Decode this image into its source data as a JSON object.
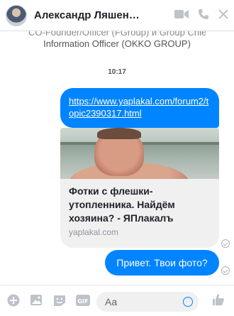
{
  "header": {
    "contact_name": "Александр Ляшенко",
    "icons": [
      "avatar",
      "video-call-icon",
      "phone-icon",
      "close-icon"
    ]
  },
  "previous_message": {
    "line1": "CO-Founder/Officer (FGroup) и Group Chief",
    "line2": "Information Officer (OKKO GROUP)"
  },
  "thread": {
    "timestamp": "10:17",
    "link_message": "https://www.yaplakal.com/forum2/topic2390317.html",
    "link_preview": {
      "title": "Фотки с флешки-утопленника. Найдём хозяина? - ЯПлакалъ",
      "domain": "yaplakal.com"
    },
    "text_message": "Привет. Твои фото?"
  },
  "composer": {
    "placeholder": "Aa",
    "icons": [
      "add-icon",
      "photo-icon",
      "sticker-icon",
      "gif-icon",
      "emoji-icon",
      "like-icon"
    ]
  },
  "colors": {
    "accent": "#0084ff",
    "bubble_gray": "#f1f0f0"
  }
}
